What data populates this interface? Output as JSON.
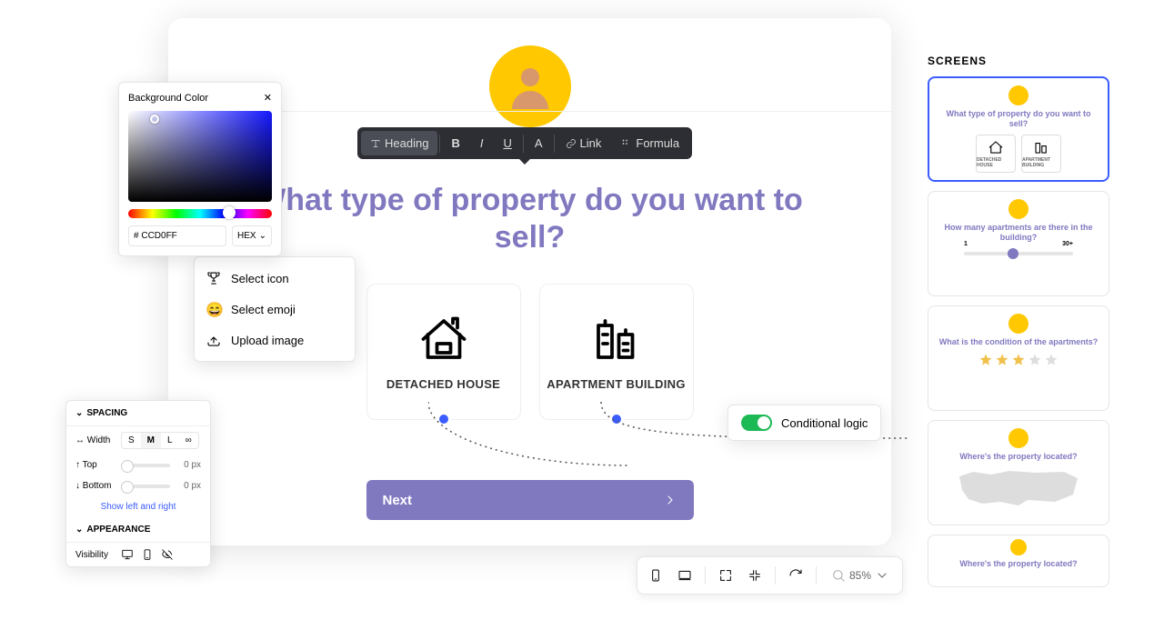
{
  "main": {
    "question": "What type of property do you want to sell?",
    "cards": [
      {
        "label": "DETACHED HOUSE",
        "icon": "house"
      },
      {
        "label": "APARTMENT BUILDING",
        "icon": "building"
      }
    ],
    "next_label": "Next"
  },
  "toolbar": {
    "heading": "Heading",
    "link": "Link",
    "formula": "Formula"
  },
  "color_panel": {
    "title": "Background Color",
    "hex": "CCD0FF",
    "mode": "HEX"
  },
  "icon_menu": {
    "items": [
      {
        "label": "Select icon",
        "icon": "trophy"
      },
      {
        "label": "Select emoji",
        "icon": "emoji"
      },
      {
        "label": "Upload image",
        "icon": "upload"
      }
    ]
  },
  "conditional": {
    "label": "Conditional logic"
  },
  "spacing": {
    "section": "SPACING",
    "width_label": "Width",
    "width_options": [
      "S",
      "M",
      "L",
      "∞"
    ],
    "width_value": "M",
    "top_label": "Top",
    "top_value": "0",
    "top_unit": "px",
    "bottom_label": "Bottom",
    "bottom_value": "0",
    "bottom_unit": "px",
    "link": "Show left and right",
    "appearance_section": "APPEARANCE",
    "visibility_label": "Visibility"
  },
  "bottom_toolbar": {
    "zoom": "85%"
  },
  "screens": {
    "title": "SCREENS",
    "items": [
      {
        "question": "What type of property do you want to sell?",
        "type": "cards",
        "cardA": "DETACHED HOUSE",
        "cardB": "APARTMENT BUILDING"
      },
      {
        "question": "How many apartments are there in the building?",
        "type": "slider",
        "min": "1",
        "max": "30+"
      },
      {
        "question": "What is the condition of the apartments?",
        "type": "stars",
        "rating": 3
      },
      {
        "question": "Where's the property located?",
        "type": "map"
      },
      {
        "question": "Where's the property located?",
        "type": "short"
      }
    ]
  }
}
